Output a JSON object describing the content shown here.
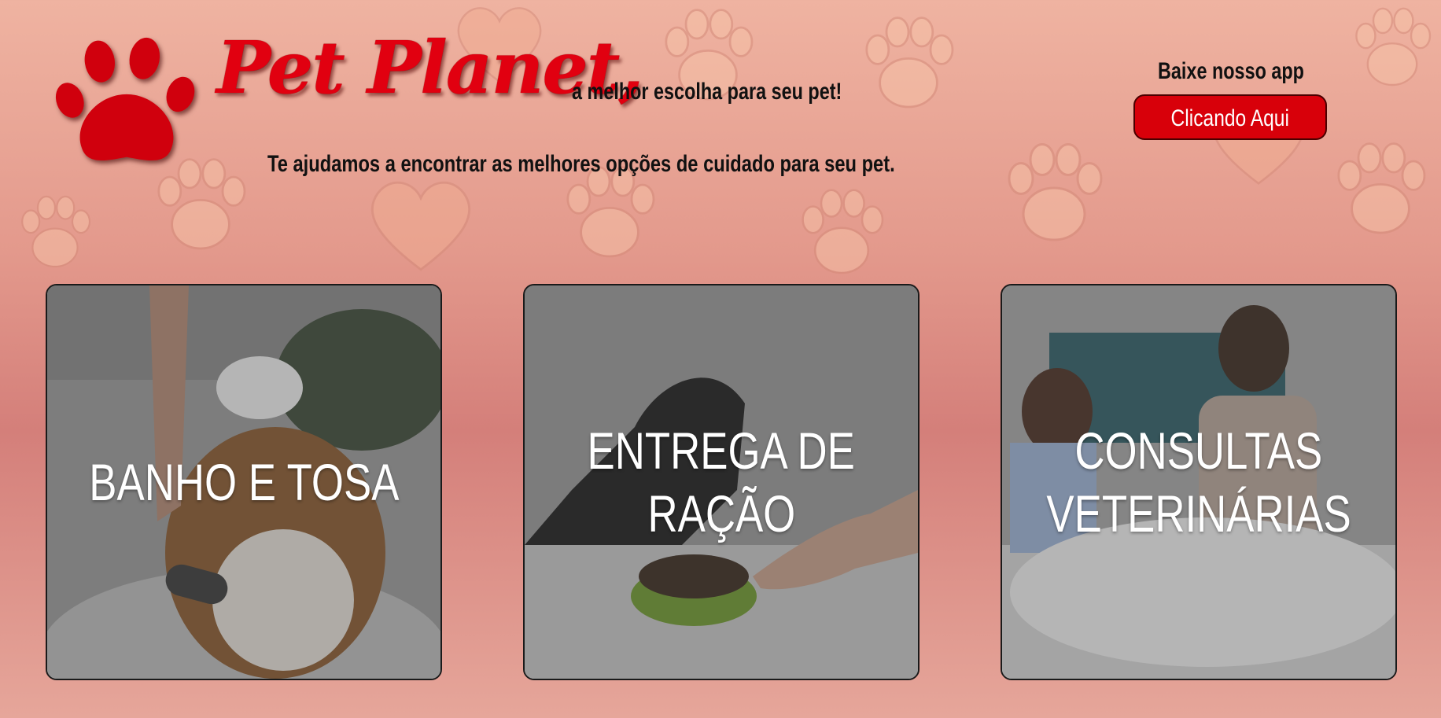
{
  "header": {
    "brand": "Pet Planet,",
    "tagline": "a melhor escolha para seu pet!",
    "subtitle": "Te ajudamos a encontrar as melhores opções de cuidado para seu pet.",
    "logo_icon": "paw-print-icon"
  },
  "app": {
    "label": "Baixe nosso app",
    "button_label": "Clicando Aqui"
  },
  "services": [
    {
      "line1": "BANHO E TOSA",
      "line2": "",
      "image": "dog-bath-photo"
    },
    {
      "line1": "ENTREGA DE",
      "line2": "RAÇÃO",
      "image": "dog-food-bowl-photo"
    },
    {
      "line1": "CONSULTAS",
      "line2": "VETERINÁRIAS",
      "image": "vet-consultation-photo"
    }
  ],
  "colors": {
    "brand_red": "#e10010",
    "button_red": "#d8000a",
    "background": "#e3998c"
  }
}
